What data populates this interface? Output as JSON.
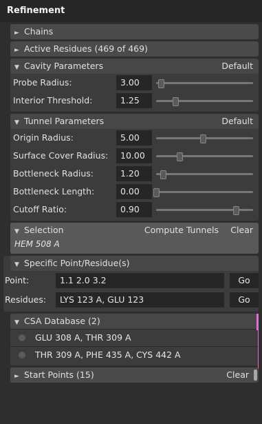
{
  "title": "Refinement",
  "chains": {
    "label": "Chains"
  },
  "active_residues": {
    "label": "Active Residues (469 of 469)"
  },
  "cavity": {
    "label": "Cavity Parameters",
    "default_label": "Default",
    "params": [
      {
        "label": "Probe Radius:",
        "value": "3.00",
        "slider": 0.05
      },
      {
        "label": "Interior Threshold:",
        "value": "1.25",
        "slider": 0.2
      }
    ]
  },
  "tunnel": {
    "label": "Tunnel Parameters",
    "default_label": "Default",
    "params": [
      {
        "label": "Origin Radius:",
        "value": "5.00",
        "slider": 0.48
      },
      {
        "label": "Surface Cover Radius:",
        "value": "10.00",
        "slider": 0.24
      },
      {
        "label": "Bottleneck Radius:",
        "value": "1.20",
        "slider": 0.07
      },
      {
        "label": "Bottleneck Length:",
        "value": "0.00",
        "slider": 0.0
      },
      {
        "label": "Cutoff Ratio:",
        "value": "0.90",
        "slider": 0.82
      }
    ]
  },
  "selection": {
    "label": "Selection",
    "compute_label": "Compute Tunnels",
    "clear_label": "Clear",
    "value": "HEM 508 A"
  },
  "specific": {
    "label": "Specific Point/Residue(s)",
    "point_label": "Point:",
    "point_value": "1.1 2.0 3.2",
    "residues_label": "Residues:",
    "residues_value": "LYS 123 A, GLU 123",
    "go_label": "Go"
  },
  "csa": {
    "label": "CSA Database (2)",
    "items": [
      {
        "label": "GLU 308 A, THR 309 A"
      },
      {
        "label": "THR 309 A, PHE 435 A, CYS 442 A"
      }
    ]
  },
  "start_points": {
    "label": "Start Points (15)",
    "clear_label": "Clear"
  },
  "colors": {
    "accent": "#e070d0"
  }
}
